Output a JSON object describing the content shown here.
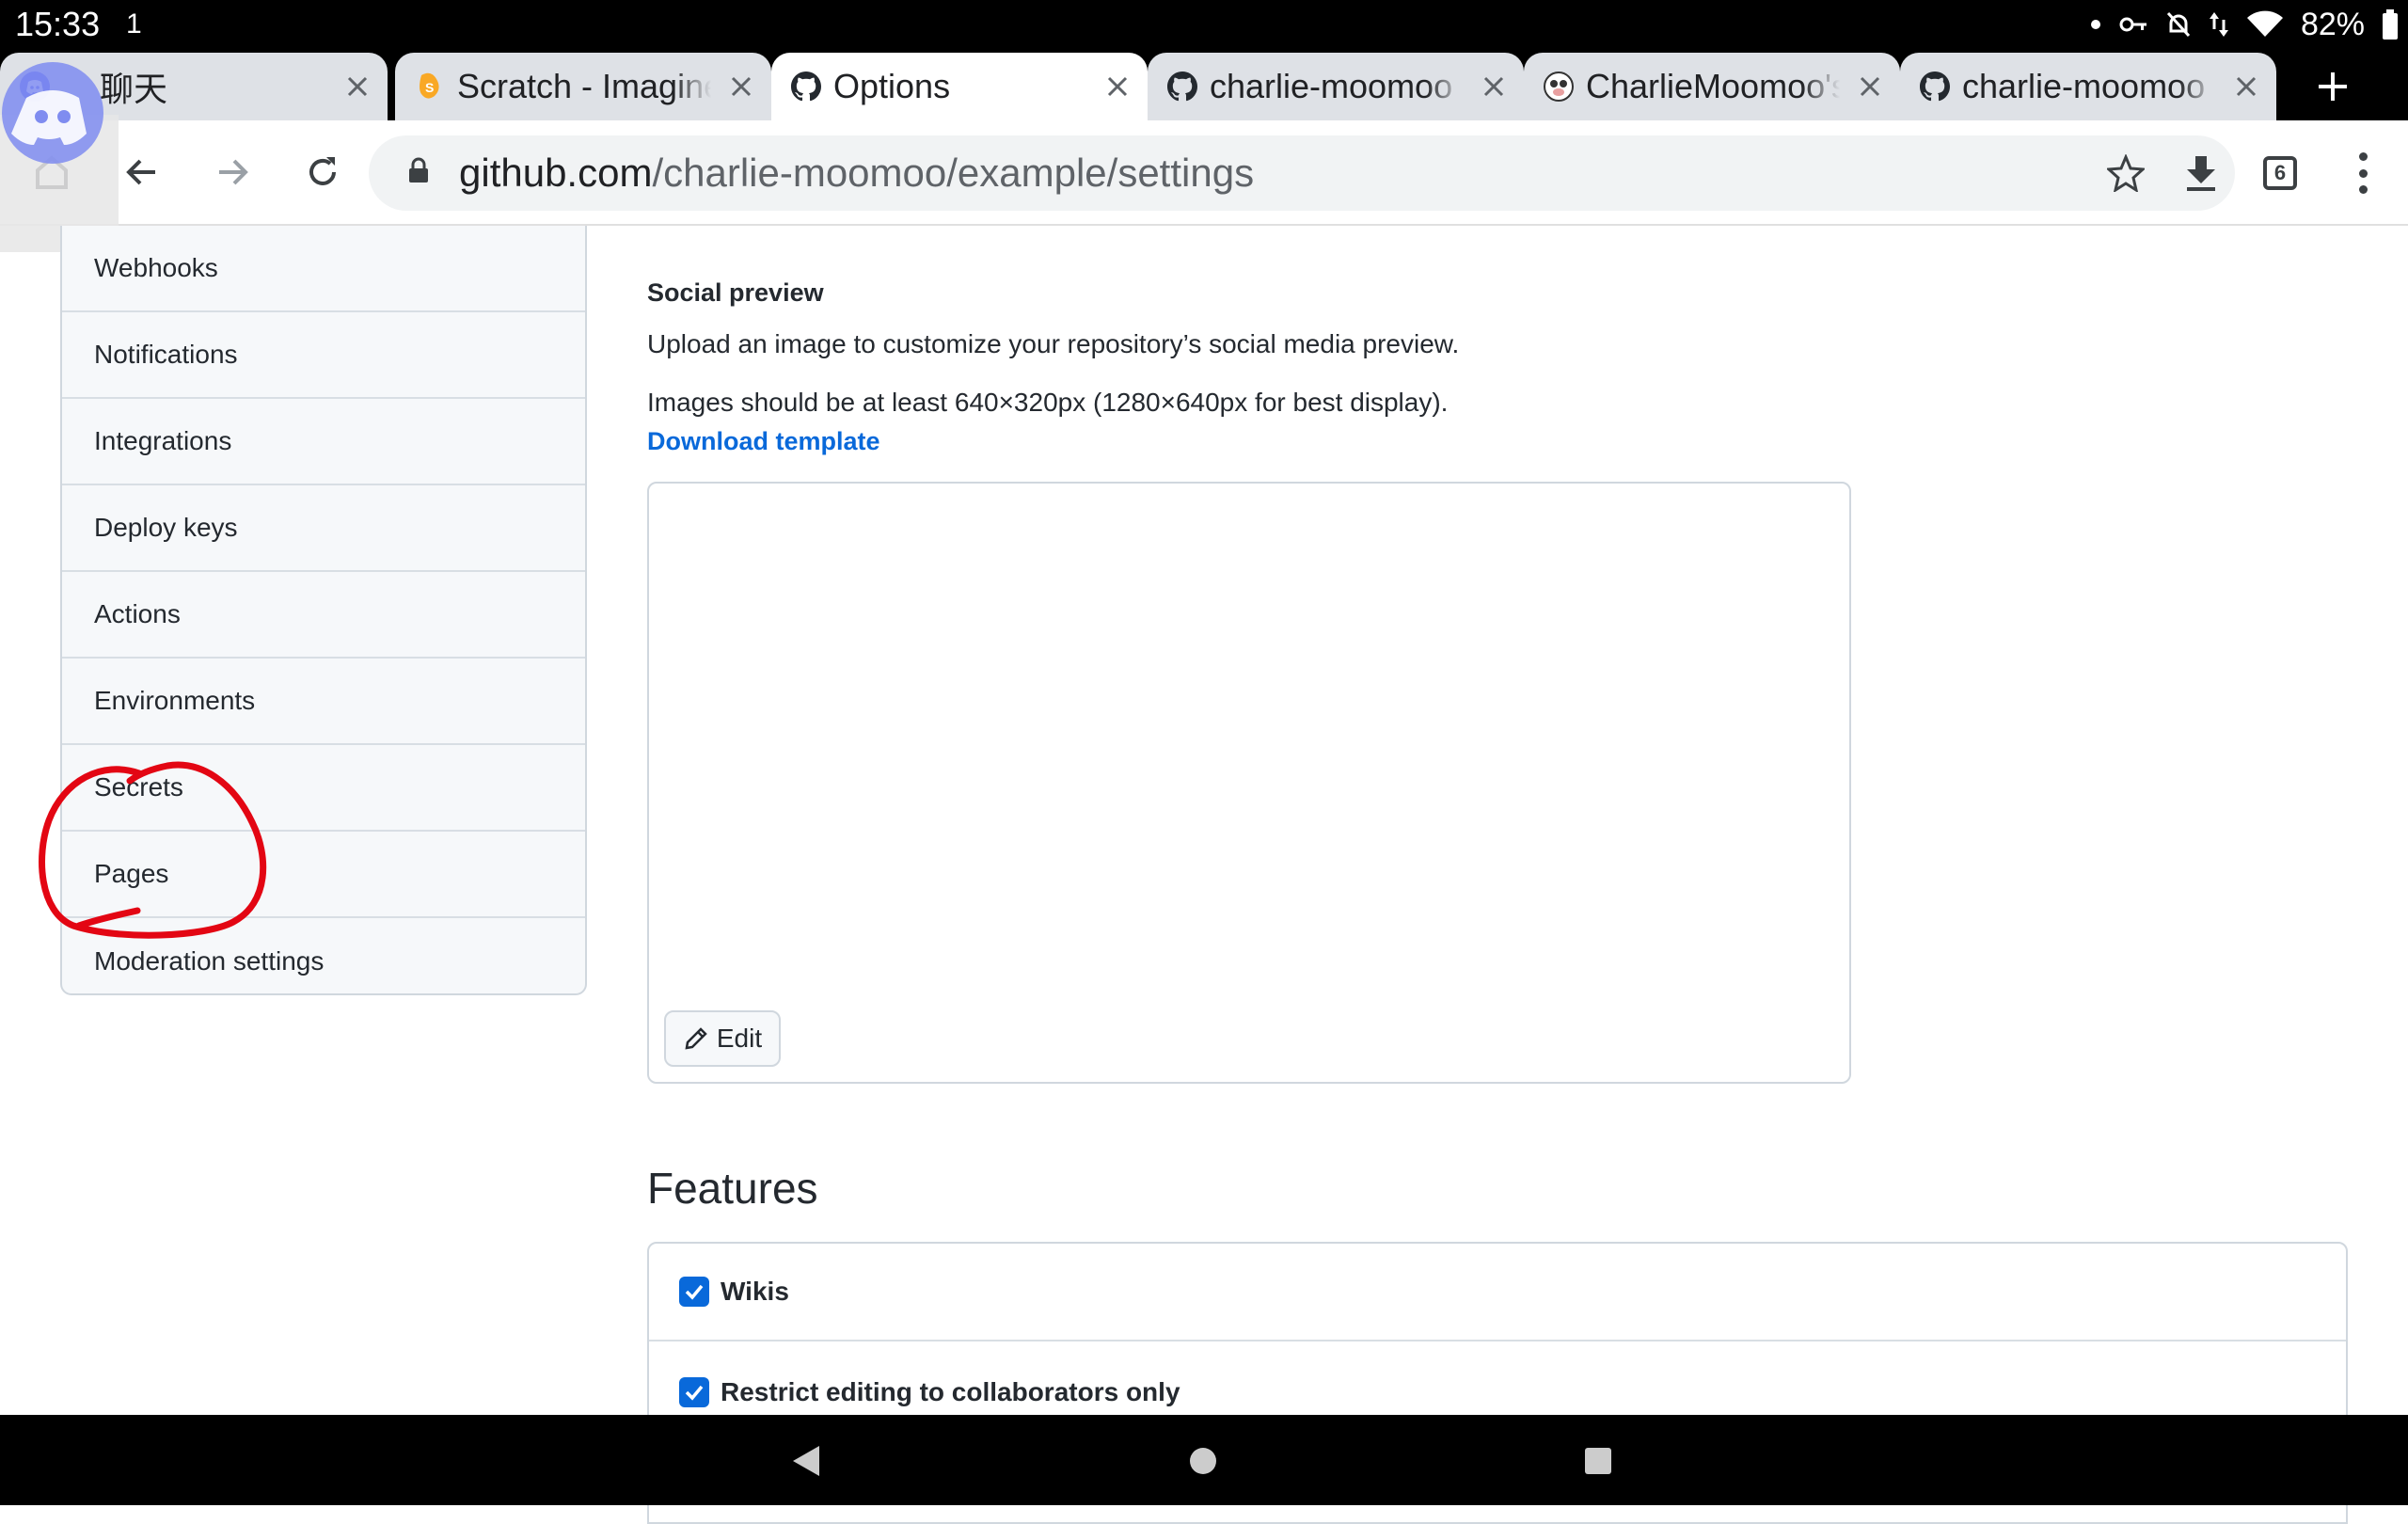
{
  "status_bar": {
    "time": "15:33",
    "notification": "1",
    "battery": "82%"
  },
  "tabs": [
    {
      "title": "聊天",
      "icon": "discord-icon",
      "active": false
    },
    {
      "title": "Scratch - Imagine, Program, Share",
      "icon": "scratch-icon",
      "active": false
    },
    {
      "title": "Options",
      "icon": "github-icon",
      "active": true
    },
    {
      "title": "charlie-moomoo",
      "icon": "github-icon",
      "active": false
    },
    {
      "title": "CharlieMoomoo's",
      "icon": "avatar-icon",
      "active": false
    },
    {
      "title": "charlie-moomoo",
      "icon": "github-icon",
      "active": false
    }
  ],
  "toolbar": {
    "url_host": "github.com",
    "url_path": "/charlie-moomoo/example/settings",
    "tab_count": "6"
  },
  "sidebar": {
    "items": [
      {
        "label": "Webhooks"
      },
      {
        "label": "Notifications"
      },
      {
        "label": "Integrations"
      },
      {
        "label": "Deploy keys"
      },
      {
        "label": "Actions"
      },
      {
        "label": "Environments"
      },
      {
        "label": "Secrets"
      },
      {
        "label": "Pages"
      },
      {
        "label": "Moderation settings"
      }
    ]
  },
  "social_preview": {
    "heading": "Social preview",
    "description": "Upload an image to customize your repository’s social media preview.",
    "requirement": "Images should be at least 640×320px (1280×640px for best display).",
    "download_link": "Download template",
    "edit_label": "Edit"
  },
  "features": {
    "heading": "Features",
    "items": [
      {
        "label": "Wikis",
        "checked": true
      },
      {
        "label": "Restrict editing to collaborators only",
        "checked": true
      }
    ]
  },
  "colors": {
    "link": "#0969da",
    "annotation": "#e30613",
    "checkbox": "#0969da"
  }
}
